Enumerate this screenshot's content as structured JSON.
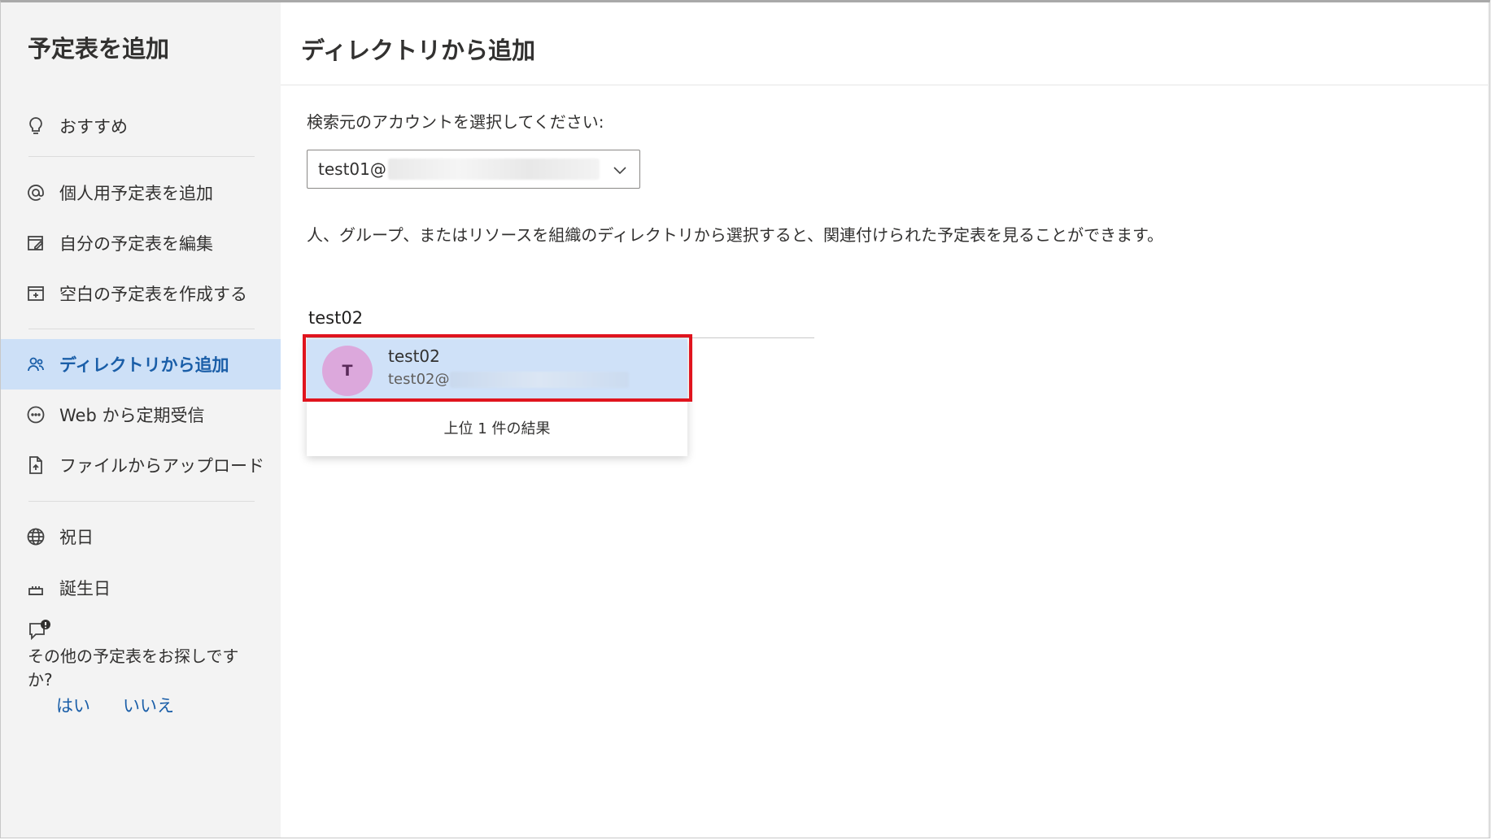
{
  "sidebar": {
    "title": "予定表を追加",
    "items": [
      {
        "label": "おすすめ",
        "icon": "lightbulb-icon"
      },
      {
        "label": "個人用予定表を追加",
        "icon": "at-sign-icon"
      },
      {
        "label": "自分の予定表を編集",
        "icon": "edit-calendar-icon"
      },
      {
        "label": "空白の予定表を作成する",
        "icon": "new-calendar-icon"
      },
      {
        "label": "ディレクトリから追加",
        "icon": "people-icon",
        "active": true
      },
      {
        "label": "Web から定期受信",
        "icon": "ellipsis-circle-icon"
      },
      {
        "label": "ファイルからアップロード",
        "icon": "file-upload-icon"
      },
      {
        "label": "祝日",
        "icon": "globe-icon"
      },
      {
        "label": "誕生日",
        "icon": "cake-icon"
      }
    ],
    "feedback": {
      "icon": "feedback-icon",
      "question": "その他の予定表をお探しですか?",
      "yes": "はい",
      "no": "いいえ"
    }
  },
  "main": {
    "title": "ディレクトリから追加",
    "account_label": "検索元のアカウントを選択してください:",
    "account_value": "test01@",
    "description": "人、グループ、またはリソースを組織のディレクトリから選択すると、関連付けられた予定表を見ることができます。",
    "search_value": "test02",
    "results": [
      {
        "initial": "T",
        "name": "test02",
        "email": "test02@"
      }
    ],
    "results_footer": "上位 1 件の結果"
  },
  "colors": {
    "accent": "#1a5ea8",
    "active_bg": "#cde0f7",
    "highlight_border": "#e0141e",
    "avatar_bg": "#dca8dc"
  }
}
